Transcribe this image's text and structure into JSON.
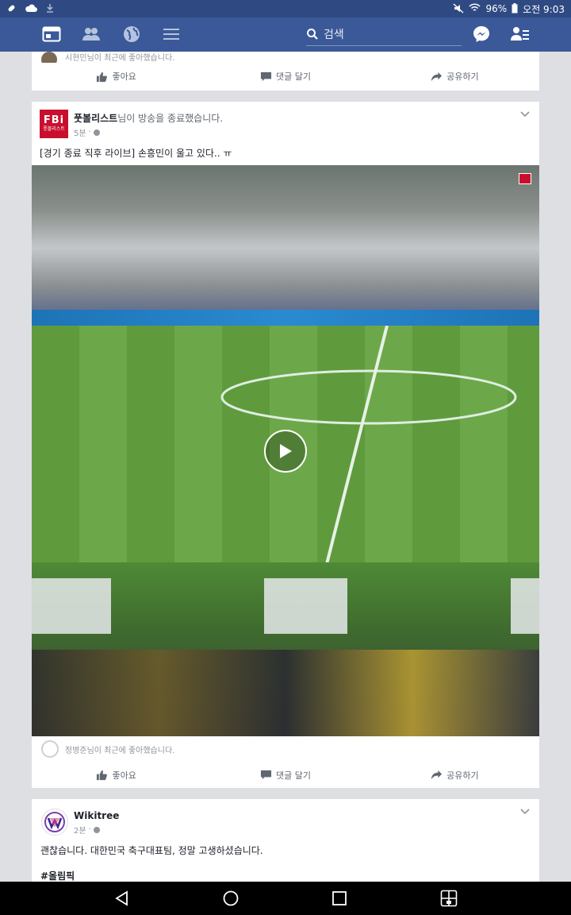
{
  "status_bar": {
    "battery": "96%",
    "time": "오전 9:03"
  },
  "nav": {
    "search_placeholder": "검색"
  },
  "card1": {
    "liker_text": "시현민님이 최근에 좋아했습니다.",
    "actions": {
      "like": "좋아요",
      "comment": "댓글 달기",
      "share": "공유하기"
    }
  },
  "post": {
    "page_name": "풋볼리스트",
    "title_rest": "님이 방송을 종료했습니다.",
    "avatar_text": "FBi",
    "avatar_subtext": "풋볼리스트",
    "time": "5분",
    "text": "[경기 종료 직후 라이브] 손흥민이 울고 있다.. ㅠ",
    "liker_text": "정병준님이 최근에 좋아했습니다.",
    "actions": {
      "like": "좋아요",
      "comment": "댓글 달기",
      "share": "공유하기"
    }
  },
  "post2": {
    "page_name": "Wikitree",
    "time": "2분",
    "text": "괜찮습니다. 대한민국 축구대표팀, 정말 고생하셨습니다.",
    "hashtag": "#올림픽"
  },
  "colors": {
    "facebook_blue": "#3b5998",
    "status_bar": "#2f4a83",
    "brand_red": "#c8102e"
  }
}
